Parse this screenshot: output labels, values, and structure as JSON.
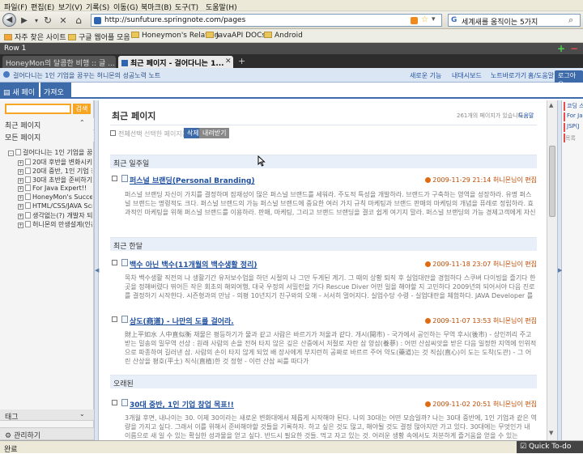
{
  "browser": {
    "menu": [
      "파일(F)",
      "편집(E)",
      "보기(V)",
      "기록(S)",
      "이동(G)",
      "북마크(B)",
      "도구(T)",
      "도움말(H)"
    ],
    "url": "http://sunfuture.springnote.com/pages",
    "search_value": "세계새를 움직이는 5가지",
    "bookmarks": [
      "자주 찾은 사이트",
      "구글 웹어플 모음",
      "Honeymon's Relation",
      "JavaAPI DOCs",
      "Android"
    ],
    "row_label": "Row 1",
    "tabs": [
      "HoneyMon의 달콤한 비행 :: 글 ...",
      "최근 페이지 - 걸어다니는 1..."
    ],
    "status": "완료",
    "status_right": "Quick To-do"
  },
  "springnote": {
    "notice": "걸어다니는 1인 기업을 꿈꾸는 허니몬의 성공노력 노트",
    "header_links": [
      "새로운 기능",
      "내대시보드",
      "노트바로가기",
      "홈/도움말"
    ],
    "logout": "로그아웃",
    "top_tabs": [
      "새 페이지",
      "가져오기"
    ],
    "search_button": "검색",
    "recent_label": "최근 페이지",
    "all_pages_label": "모든 페이지",
    "tree": [
      {
        "label": "걸어다니는 1인 기업을 꿈꾸",
        "level": 0,
        "pm": "-"
      },
      {
        "label": "20대 후반을 변화시키는",
        "level": 1,
        "pm": "+"
      },
      {
        "label": "20대 중반, 1인 기업 창",
        "level": 1,
        "pm": "+"
      },
      {
        "label": "30대 초반을 준비하기",
        "level": 1,
        "pm": "+"
      },
      {
        "label": "For Java Expert!!",
        "level": 1,
        "pm": "+"
      },
      {
        "label": "HoneyMon's Success",
        "level": 1,
        "pm": "+"
      },
      {
        "label": "HTML/CSS/JAVA Scr",
        "level": 1,
        "pm": "+"
      },
      {
        "label": "생각없는(?) 개발자 되기",
        "level": 1,
        "pm": "+"
      },
      {
        "label": "허니몬의 만생설계(인간",
        "level": 1,
        "pm": "+"
      }
    ],
    "tag_label": "태그",
    "manage_label": "관리하기",
    "right_items": [
      "코딩 스",
      "For Ja",
      "JSP(J",
      "",
      "목록"
    ]
  },
  "main": {
    "title": "최근 페이지",
    "count_text": "261개의 페이지가 있습니다.",
    "help_link": "도움말",
    "select_all": "전체선택",
    "selected_label": "선택한 페이지를",
    "delete_btn": "삭제",
    "export_btn": "내려받기",
    "sections": [
      {
        "heading": "최근 일주일",
        "entries": [
          {
            "title": "퍼스널 브랜딩(Personal Branding)",
            "meta": "2009-11-29 21:14 허니몬님이 편집",
            "body": "퍼스널 브랜딩 자신이 가치를 결정하며 잠재성이 많은 퍼스널 브랜드를 세워라. 주도적 특성을 개발하라. 브랜드가 구축하는 영역을 성장하라. 유명 퍼스널 브랜드는 명령적도 크다. 퍼스널 브랜드의 가능 퍼스널 브랜드에 중요한 여러 가지 규칙 마케팅과 브랜드 판매의 마케팅의 개념을 퓨레로 정립하라. 효과적인 마케팅을 위해 퍼스널 브랜드를 이용하라. 판매, 마케팅, 그리고 브랜드 브랜딩을 결코 쉽게 여기지 말라. 퍼스널 브랜딩의 가능 경제고객에게 자신의 퍼스널 브랜드를 노출하라. 퍼스널 브랜드의 세가지 단계 문화적 게"
          }
        ]
      },
      {
        "heading": "최근 한달",
        "entries": [
          {
            "title": "백수 아닌 백수(11개월의 백수생활 정리)",
            "meta": "2009-11-18 23:07 허니몬님이 편집",
            "body": "목차 백수생활 직전의 나 생활기간 유저보수업을 하던 시절의 나 그만 두게된 계기. 그 때의 상황 퇴직 후 실업대란을 경험하다 스쿠버 다이빙을 즐기다 한 곳을 정해버렸다 뛰어든 작은 회초의 해외여행, 대국 우정의 서밀런을 가다 Rescue Diver 어떤 일을 해야할 지 고민하다 2009년의 되어서야 다음 진로를 결정하기 시작한다. 시즌형과의 만남 - 의평 10년지기 친구와의 오해 - 서서히 멀어지다. 실업수당 수령 - 실업대란을 체험하다. JAVA Developer 를 꿈꾸다 대학시절 꿈꾸던 프로그래머의"
          },
          {
            "title": "상도(商道) - 나만의 도를 걸어라.",
            "meta": "2009-11-07 13:53 허니몬님이 편집",
            "body": "財上平如水 人中直似衡 재물은 평등하기가 물과 같고 사람은 바르기가 저울과 같다. 개시(開市) - 국가에서 공인하는 무역 후시(後市) - 상인끼리 주고 받는 밀송의 밀무역 선상 : 원래 사람의 손을 전혀 타지 않은 깊은 산중에서 저절로 자란 삼 양삼(養蔘) : 어떤 산삼씨앗을 받은 다음 일정한 지역에 인위적으로 파종하여 길러낸 삼. 사람의 손이 타지 않게 되었 배 장사에게 부지런히 공짜로 바르르 주어 약도(藥道)는 것 직심(直心)이 도는 도착(도관) - 그 어린 산상을 평호(平土) 직식(直植)한 것 정형 - 이런 산삼 씨를 따다가"
          }
        ]
      },
      {
        "heading": "오래된",
        "entries": [
          {
            "title": "30대 중반, 1인 기업 창업 목표!!",
            "meta": "2009-11-02 20:51 허니몬님이 편집",
            "body": "3개월 후면, 내나이는 30. 이제 30이라는 새로운 변화대에서 제롭게 시작해야 된다. 나의 30대는 어떤 모습일까? 나는 30대 중반에, 1인 기업과 같은 역량을 가지고 싶다. 그래서 이를 위해서 준비해야할 것들을 기록하자. 하고 싶은 것도 많고, 해야될 것도 결정 많아지만 가고 있다. 30대에는 무엇인가 내 이름으로 새 일 수 있는 확실한 성과물을 얻고 싶다. 반드시 필요한 것들. 먹고 자고 있는 것. 어려운 생황 속에서도 처분하게 즐거움을 얻을 수 있는"
          }
        ]
      }
    ]
  }
}
